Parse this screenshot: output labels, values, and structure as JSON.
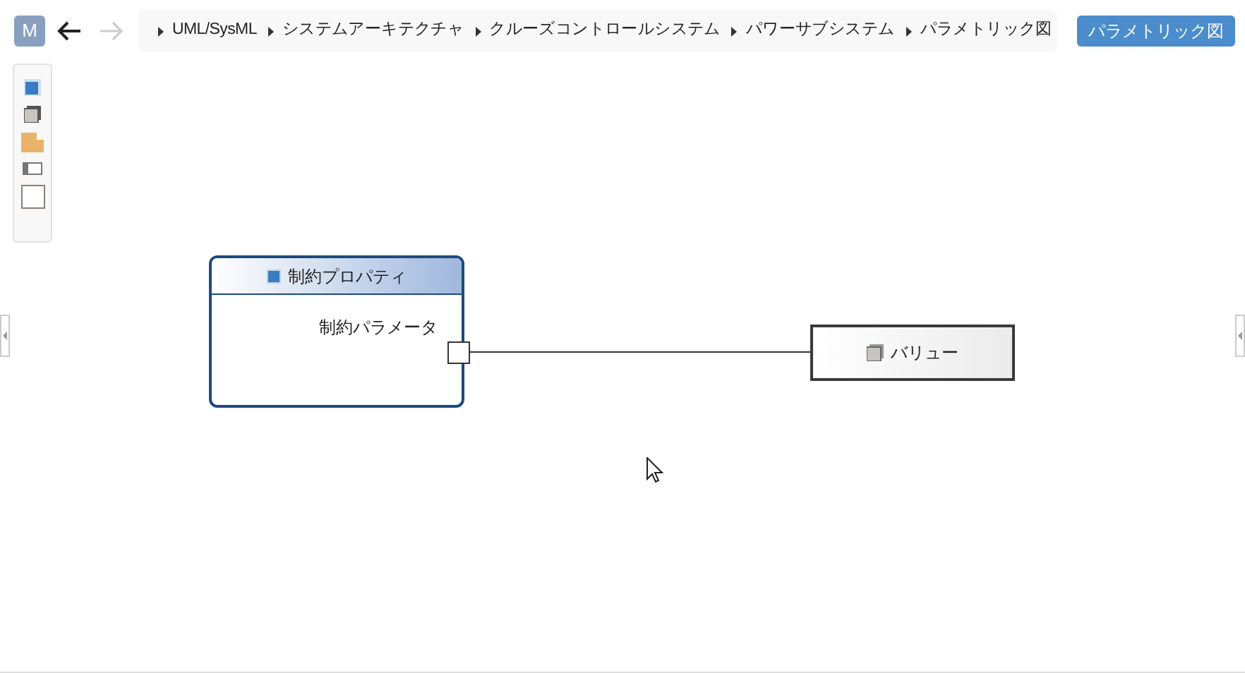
{
  "app_logo": {
    "letter": "M"
  },
  "breadcrumb": [
    {
      "label": "UML/SysML"
    },
    {
      "label": "システムアーキテクチャ"
    },
    {
      "label": "クルーズコントロールシステム"
    },
    {
      "label": "パワーサブシステム"
    },
    {
      "label": "パラメトリック図"
    }
  ],
  "diagram_type_button": {
    "label": "パラメトリック図"
  },
  "palette": [
    {
      "kind": "block"
    },
    {
      "kind": "value"
    },
    {
      "kind": "note"
    },
    {
      "kind": "toggle"
    },
    {
      "kind": "frame"
    }
  ],
  "diagram": {
    "constraint_block": {
      "title": "制約プロパティ",
      "parameter": "制約パラメータ"
    },
    "value_block": {
      "title": "バリュー"
    }
  }
}
